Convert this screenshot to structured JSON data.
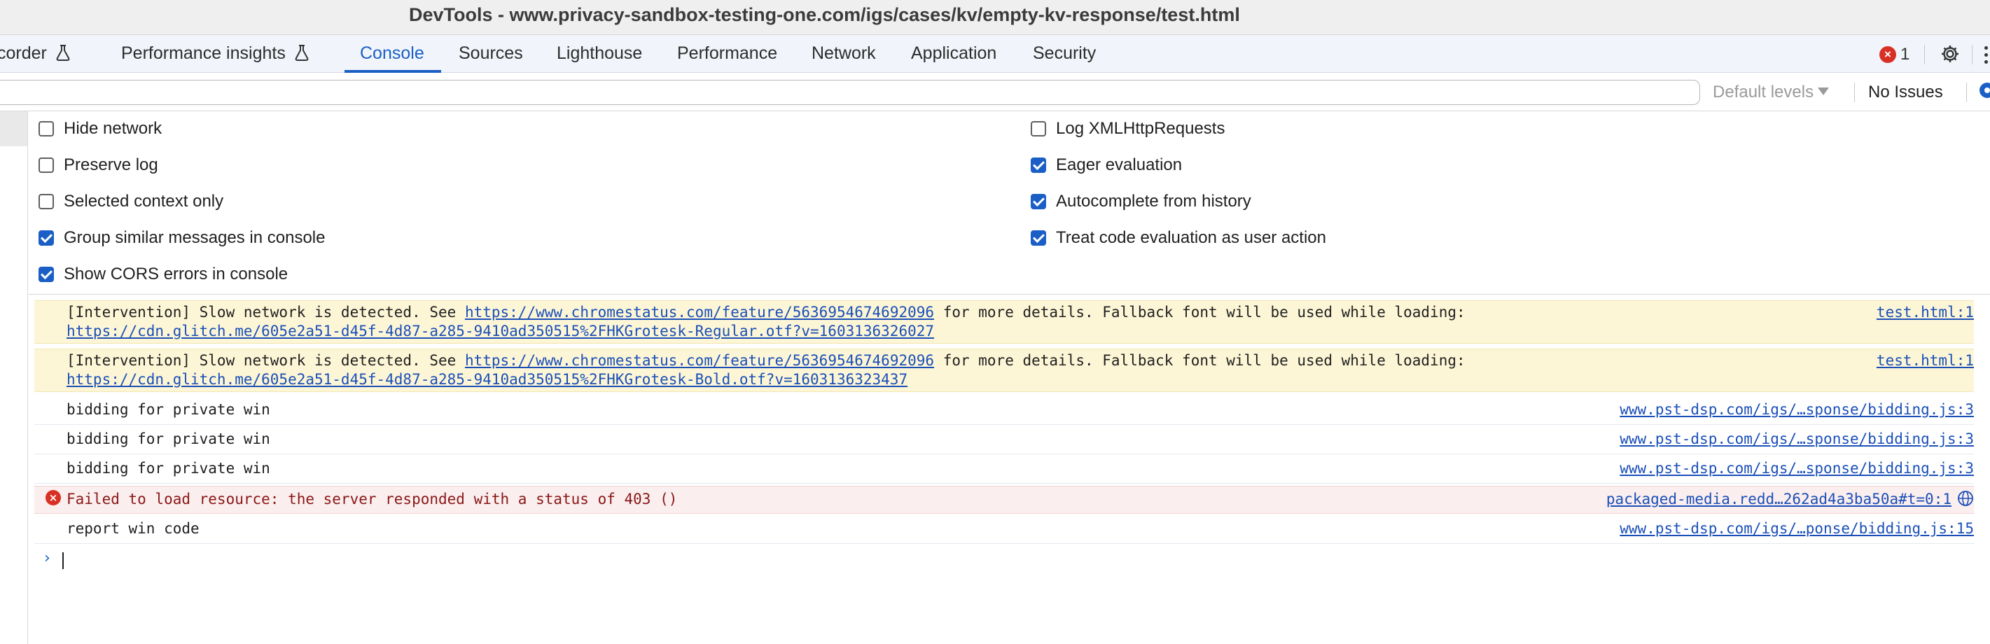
{
  "window": {
    "title": "DevTools - www.privacy-sandbox-testing-one.com/igs/cases/kv/empty-kv-response/test.html"
  },
  "tabs": [
    {
      "label": "corder",
      "experimental": true
    },
    {
      "label": "Performance insights",
      "experimental": true
    },
    {
      "label": "Console",
      "active": true
    },
    {
      "label": "Sources"
    },
    {
      "label": "Lighthouse"
    },
    {
      "label": "Performance"
    },
    {
      "label": "Network"
    },
    {
      "label": "Application"
    },
    {
      "label": "Security"
    }
  ],
  "toolbar": {
    "error_count": "1",
    "error_icon_glyph": "×"
  },
  "filter": {
    "placeholder": "",
    "levels_label": "Default levels",
    "issues_label": "No Issues"
  },
  "settings": {
    "left": [
      {
        "label": "Hide network",
        "checked": false
      },
      {
        "label": "Preserve log",
        "checked": false
      },
      {
        "label": "Selected context only",
        "checked": false
      },
      {
        "label": "Group similar messages in console",
        "checked": true
      },
      {
        "label": "Show CORS errors in console",
        "checked": true
      }
    ],
    "right": [
      {
        "label": "Log XMLHttpRequests",
        "checked": false
      },
      {
        "label": "Eager evaluation",
        "checked": true
      },
      {
        "label": "Autocomplete from history",
        "checked": true
      },
      {
        "label": "Treat code evaluation as user action",
        "checked": true
      }
    ]
  },
  "messages": [
    {
      "level": "warning",
      "prefix": "[Intervention] Slow network is detected. See ",
      "link": "https://www.chromestatus.com/feature/5636954674692096",
      "suffix": " for more details. Fallback font will be used while loading:",
      "line2": "https://cdn.glitch.me/605e2a51-d45f-4d87-a285-9410ad350515%2FHKGrotesk-Regular.otf?v=1603136326027",
      "source": "test.html:1"
    },
    {
      "level": "warning",
      "prefix": "[Intervention] Slow network is detected. See ",
      "link": "https://www.chromestatus.com/feature/5636954674692096",
      "suffix": " for more details. Fallback font will be used while loading:",
      "line2": "https://cdn.glitch.me/605e2a51-d45f-4d87-a285-9410ad350515%2FHKGrotesk-Bold.otf?v=1603136323437",
      "source": "test.html:1"
    },
    {
      "level": "log",
      "text": "bidding for private win",
      "source": "www.pst-dsp.com/igs/…sponse/bidding.js:3"
    },
    {
      "level": "log",
      "text": "bidding for private win",
      "source": "www.pst-dsp.com/igs/…sponse/bidding.js:3"
    },
    {
      "level": "log",
      "text": "bidding for private win",
      "source": "www.pst-dsp.com/igs/…sponse/bidding.js:3"
    },
    {
      "level": "error",
      "text": "Failed to load resource: the server responded with a status of 403 ()",
      "source": "packaged-media.redd…262ad4a3ba50a#t=0:1"
    },
    {
      "level": "log",
      "text": "report win code",
      "source": "www.pst-dsp.com/igs/…ponse/bidding.js:15"
    }
  ],
  "prompt": {
    "glyph": "›"
  },
  "colors": {
    "accent": "#1b5fc6",
    "warning_bg": "#fdf6d6",
    "error_bg": "#fbeeee",
    "error_red": "#d93025"
  }
}
